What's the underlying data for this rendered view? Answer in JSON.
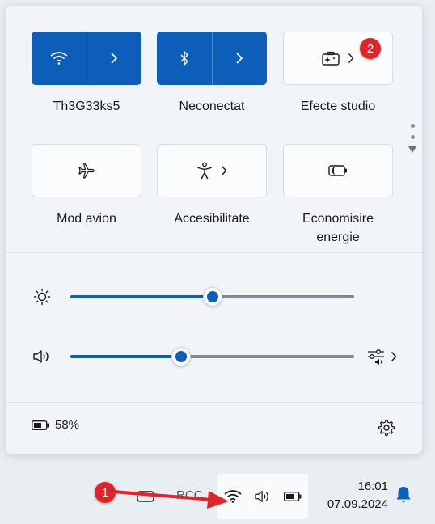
{
  "quick_settings": {
    "tiles": [
      {
        "label": "Th3G33ks5",
        "icon": "wifi-icon",
        "active": true,
        "has_arrow": true
      },
      {
        "label": "Neconectat",
        "icon": "bluetooth-icon",
        "active": true,
        "has_arrow": true
      },
      {
        "label": "Efecte studio",
        "icon": "studio-effects-icon",
        "active": false,
        "has_arrow": true
      },
      {
        "label": "Mod avion",
        "icon": "airplane-icon",
        "active": false,
        "has_arrow": false
      },
      {
        "label": "Accesibilitate",
        "icon": "accessibility-icon",
        "active": false,
        "has_arrow": true
      },
      {
        "label": "Economisire energie",
        "label_line1": "Economisire",
        "label_line2": "energie",
        "icon": "energy-saver-icon",
        "active": false,
        "has_arrow": false
      }
    ],
    "page_indicator": {
      "pages": 2,
      "current": 1
    }
  },
  "sliders": {
    "brightness": {
      "icon": "brightness-icon",
      "value": 50
    },
    "volume": {
      "icon": "speaker-icon",
      "value": 39
    }
  },
  "footer": {
    "battery_text": "58%",
    "battery_icon": "battery-icon",
    "settings_icon": "gear-icon"
  },
  "annotations": {
    "badge_1": "1",
    "badge_2": "2"
  },
  "taskbar": {
    "time": "16:01",
    "date": "07.09.2024",
    "partial_text": "RCC",
    "icons": [
      "wifi-icon",
      "speaker-icon",
      "battery-icon",
      "bell-icon"
    ]
  },
  "colors": {
    "accent": "#0c5eb8",
    "badge": "#e0242a",
    "arrow": "#e0242a"
  }
}
